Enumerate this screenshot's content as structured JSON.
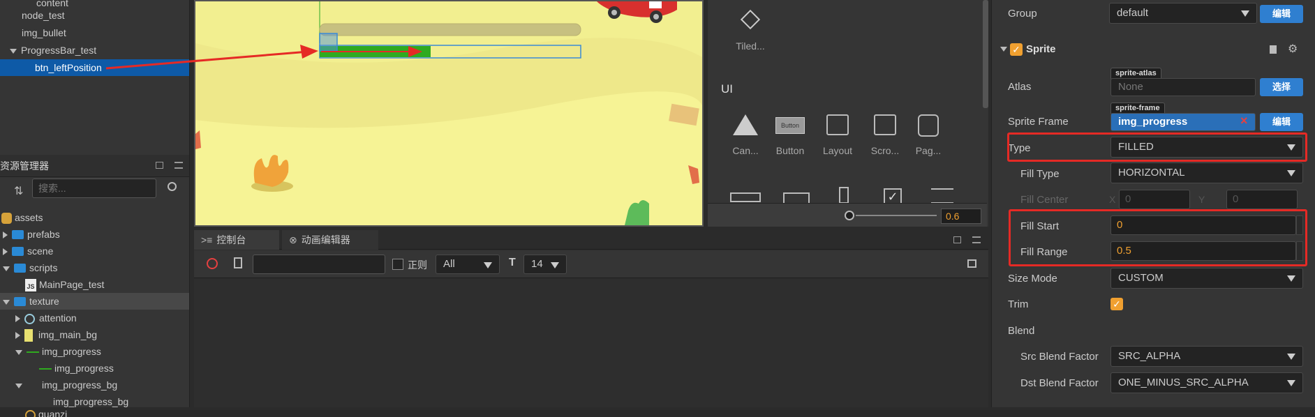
{
  "hierarchy": {
    "items": [
      {
        "label": "content"
      },
      {
        "label": "node_test"
      },
      {
        "label": "img_bullet"
      },
      {
        "label": "ProgressBar_test"
      },
      {
        "label": "btn_leftPosition"
      }
    ]
  },
  "assets": {
    "title": "资源管理器",
    "search_placeholder": "搜索...",
    "items": [
      {
        "label": "assets"
      },
      {
        "label": "prefabs"
      },
      {
        "label": "scene"
      },
      {
        "label": "scripts"
      },
      {
        "label": "MainPage_test"
      },
      {
        "label": "texture"
      },
      {
        "label": "attention"
      },
      {
        "label": "img_main_bg"
      },
      {
        "label": "img_progress"
      },
      {
        "label": "img_progress"
      },
      {
        "label": "img_progress_bg"
      },
      {
        "label": "img_progress_bg"
      },
      {
        "label": "guanzi"
      }
    ]
  },
  "widgets": {
    "tiled_label": "Tiled...",
    "section_ui": "UI",
    "items": [
      {
        "label": "Can..."
      },
      {
        "label": "Button"
      },
      {
        "label": "Layout"
      },
      {
        "label": "Scro..."
      },
      {
        "label": "Pag..."
      }
    ],
    "button_icon_text": "Button",
    "zoom_value": "0.6",
    "zoom_level": 0.0
  },
  "console": {
    "tabs": [
      {
        "label": "控制台"
      },
      {
        "label": "动画编辑器"
      }
    ],
    "regex_label": "正则",
    "filter_value": "All",
    "font_size_value": "14"
  },
  "inspector": {
    "group_label": "Group",
    "group_value": "default",
    "edit_label": "编辑",
    "component_title": "Sprite",
    "atlas_label": "Atlas",
    "atlas_tag": "sprite-atlas",
    "atlas_value": "None",
    "select_label": "选择",
    "sprite_frame_label": "Sprite Frame",
    "sprite_frame_tag": "sprite-frame",
    "sprite_frame_value": "img_progress",
    "remove_icon": "×",
    "type_label": "Type",
    "type_value": "FILLED",
    "fill_type_label": "Fill Type",
    "fill_type_value": "HORIZONTAL",
    "fill_center_label": "Fill Center",
    "fill_center_x_label": "X",
    "fill_center_x": "0",
    "fill_center_y_label": "Y",
    "fill_center_y": "0",
    "fill_start_label": "Fill Start",
    "fill_start_value": "0",
    "fill_range_label": "Fill Range",
    "fill_range_value": "0.5",
    "size_mode_label": "Size Mode",
    "size_mode_value": "CUSTOM",
    "trim_label": "Trim",
    "blend_label": "Blend",
    "src_blend_label": "Src Blend Factor",
    "src_blend_value": "SRC_ALPHA",
    "dst_blend_label": "Dst Blend Factor",
    "dst_blend_value": "ONE_MINUS_SRC_ALPHA"
  },
  "colors": {
    "accent_blue": "#2f7fd0",
    "highlight_red": "#e52a25",
    "progress_green": "#2faa1f",
    "orange_value": "#f0a030"
  }
}
